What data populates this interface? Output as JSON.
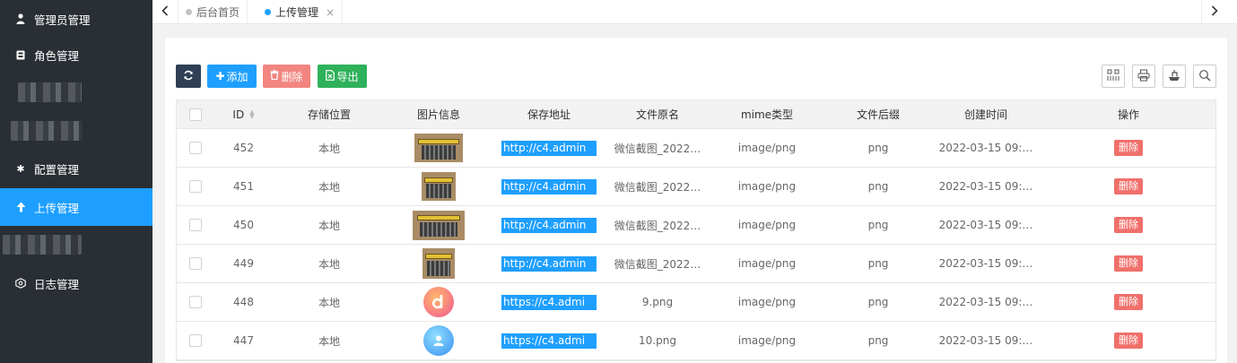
{
  "sidebar": {
    "items": [
      {
        "label": "管理员管理",
        "icon": "user-icon"
      },
      {
        "label": "角色管理",
        "icon": "role-icon"
      },
      {
        "label": "配置管理",
        "icon": "asterisk-icon"
      },
      {
        "label": "上传管理",
        "icon": "upload-arrow-icon"
      },
      {
        "label": "日志管理",
        "icon": "log-icon"
      }
    ]
  },
  "tabs": [
    {
      "label": "后台首页"
    },
    {
      "label": "上传管理",
      "close": "×"
    }
  ],
  "toolbar": {
    "add_label": "添加",
    "delete_label": "删除",
    "export_label": "导出"
  },
  "table": {
    "headers": {
      "id": "ID",
      "storage": "存储位置",
      "image": "图片信息",
      "url": "保存地址",
      "filename": "文件原名",
      "mime": "mime类型",
      "ext": "文件后缀",
      "created": "创建时间",
      "action": "操作"
    },
    "rows": [
      {
        "id": "452",
        "storage": "本地",
        "url": "http://c4.admin",
        "filename": "微信截图_2022…",
        "mime": "image/png",
        "ext": "png",
        "created": "2022-03-15 09:…",
        "action": "删除"
      },
      {
        "id": "451",
        "storage": "本地",
        "url": "http://c4.admin",
        "filename": "微信截图_2022…",
        "mime": "image/png",
        "ext": "png",
        "created": "2022-03-15 09:…",
        "action": "删除"
      },
      {
        "id": "450",
        "storage": "本地",
        "url": "http://c4.admin",
        "filename": "微信截图_2022…",
        "mime": "image/png",
        "ext": "png",
        "created": "2022-03-15 09:…",
        "action": "删除"
      },
      {
        "id": "449",
        "storage": "本地",
        "url": "http://c4.admin",
        "filename": "微信截图_2022…",
        "mime": "image/png",
        "ext": "png",
        "created": "2022-03-15 09:…",
        "action": "删除"
      },
      {
        "id": "448",
        "storage": "本地",
        "url": "https://c4.admi",
        "filename": "9.png",
        "mime": "image/png",
        "ext": "png",
        "created": "2022-03-15 09:…",
        "action": "删除"
      },
      {
        "id": "447",
        "storage": "本地",
        "url": "https://c4.admi",
        "filename": "10.png",
        "mime": "image/png",
        "ext": "png",
        "created": "2022-03-15 09:…",
        "action": "删除"
      }
    ]
  },
  "colors": {
    "sidebar_bg": "#2a2f35",
    "accent": "#1e9fff",
    "danger": "#f0706b",
    "success": "#2fb15b",
    "dark_button": "#2f4056"
  }
}
